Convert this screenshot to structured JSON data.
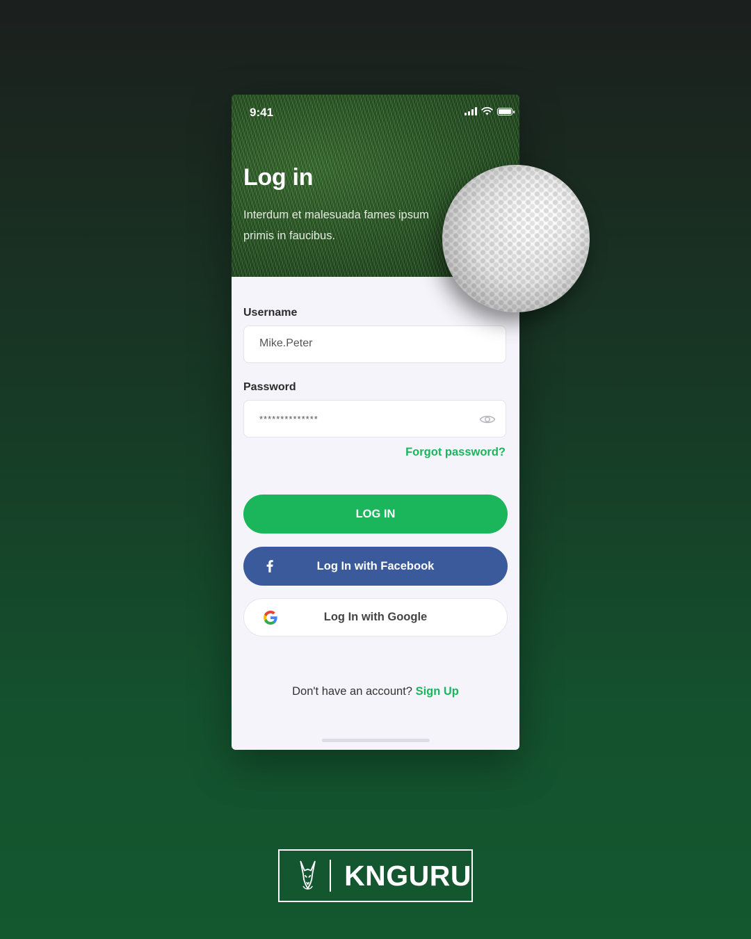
{
  "status_bar": {
    "time": "9:41"
  },
  "hero": {
    "title": "Log in",
    "subtitle": "Interdum et malesuada fames ipsum primis in faucibus."
  },
  "form": {
    "username_label": "Username",
    "username_value": "Mike.Peter",
    "password_label": "Password",
    "password_value": "**************",
    "forgot_link": "Forgot password?"
  },
  "buttons": {
    "login": "LOG IN",
    "facebook": "Log In with Facebook",
    "google": "Log In with Google"
  },
  "footer": {
    "prompt": "Don't have an account?",
    "signup": "Sign Up"
  },
  "brand": {
    "name": "KNGURU"
  },
  "colors": {
    "accent": "#1bb55c",
    "facebook": "#3a5a9c",
    "background_top": "#1b1f1e",
    "background_bottom": "#13582f"
  }
}
